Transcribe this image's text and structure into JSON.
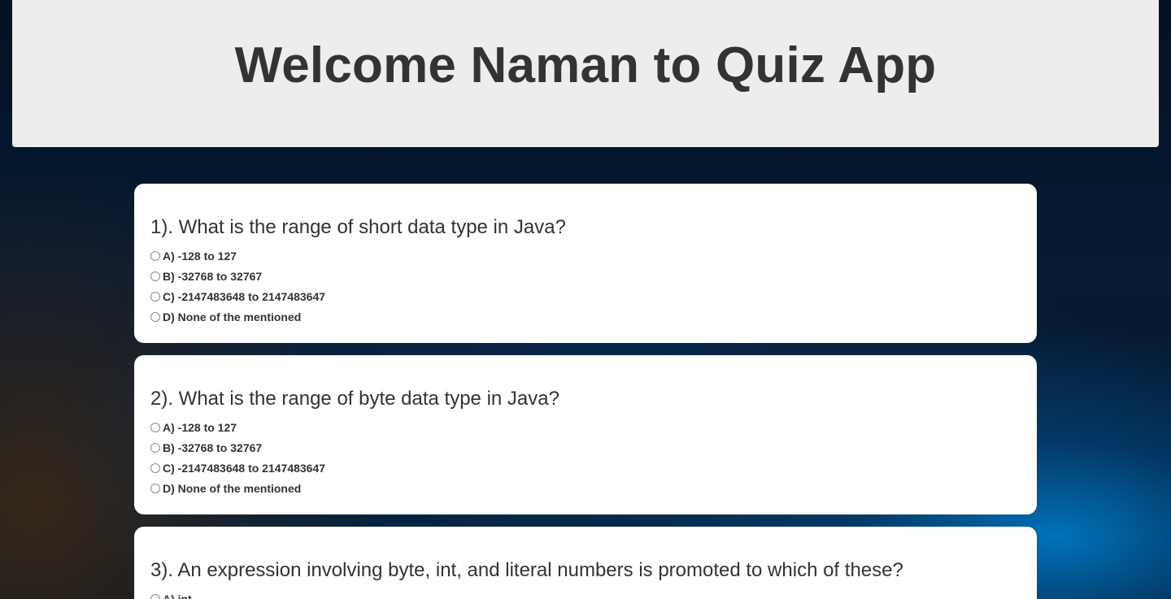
{
  "header": {
    "title": "Welcome Naman to Quiz App"
  },
  "questions": [
    {
      "text": "1). What is the range of short data type in Java?",
      "options": [
        "A) -128 to 127",
        "B) -32768 to 32767",
        "C) -2147483648 to 2147483647",
        "D) None of the mentioned"
      ]
    },
    {
      "text": "2). What is the range of byte data type in Java?",
      "options": [
        "A) -128 to 127",
        "B) -32768 to 32767",
        "C) -2147483648 to 2147483647",
        "D) None of the mentioned"
      ]
    },
    {
      "text": "3). An expression involving byte, int, and literal numbers is promoted to which of these?",
      "options": [
        "A) int"
      ]
    }
  ]
}
